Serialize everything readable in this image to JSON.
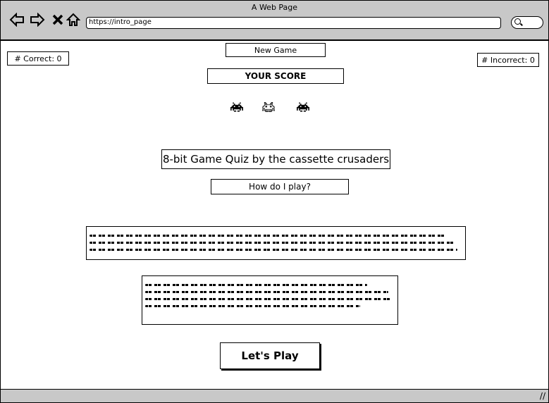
{
  "window": {
    "title": "A Web Page"
  },
  "browser": {
    "url": "https://intro_page"
  },
  "score": {
    "correct_label": "# Correct: 0",
    "incorrect_label": "# Incorrect: 0"
  },
  "buttons": {
    "new_game": "New Game",
    "your_score": "YOUR SCORE",
    "how_to_play": "How do I play?",
    "lets_play": "Let's Play"
  },
  "game": {
    "title": "8-bit Game Quiz by the cassette crusaders"
  },
  "icons": {
    "back": "back-arrow-icon",
    "forward": "forward-arrow-icon",
    "close": "close-icon",
    "home": "home-icon",
    "search": "search-icon",
    "invader": "space-invader-icon"
  }
}
